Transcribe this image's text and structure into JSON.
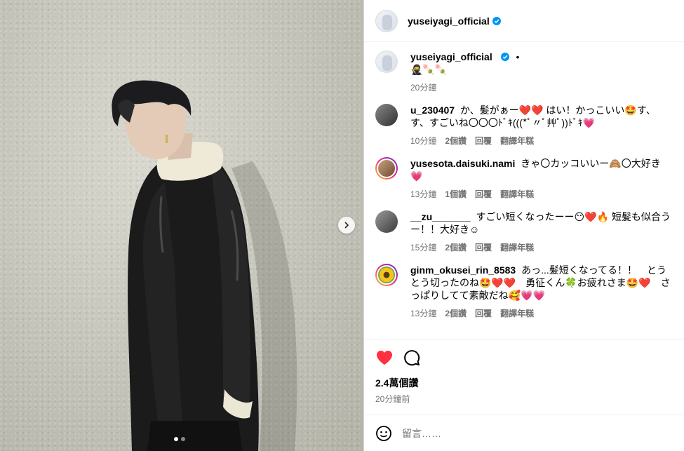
{
  "post": {
    "author": "yuseiyagi_official",
    "caption_emojis": "🥷🍡🍡",
    "caption_dot": "•",
    "caption_time": "20分鐘"
  },
  "comments": [
    {
      "user": "u_230407",
      "text": "か、髪がぁー❤️❤️ はい！かっこいい🤩す、す、すごいね〇〇〇ﾄﾞｷ(((*ﾟ〃ﾟ艸ﾟ))ﾄﾞｷ💗",
      "time": "10分鐘",
      "likes": "2個讚",
      "reply": "回覆",
      "translate": "翻譯年糕"
    },
    {
      "user": "yusesota.daisuki.nami",
      "text": "きゃ〇カッコいいー🙈〇大好き💗",
      "time": "13分鐘",
      "likes": "1個讚",
      "reply": "回覆",
      "translate": "翻譯年糕"
    },
    {
      "user": "__zu_______",
      "text": "すごい短くなったーー😶❤️🔥 短髪も似合うー！！大好き☺",
      "time": "15分鐘",
      "likes": "2個讚",
      "reply": "回覆",
      "translate": "翻譯年糕"
    },
    {
      "user": "ginm_okusei_rin_8583",
      "text": "あっ...髪短くなってる！！　とうとう切ったのね🤩❤️❤️　勇征くん🍀お疲れさま🤩❤️　さっぱりしてて素敵だね🥰💗💗",
      "time": "13分鐘",
      "likes": "2個讚",
      "reply": "回覆",
      "translate": "翻譯年糕"
    }
  ],
  "stats": {
    "views": "2.4萬個讚",
    "posted": "20分鐘前"
  },
  "comment_input": {
    "placeholder": "留言……"
  },
  "colors": {
    "like_red": "#ff3040",
    "verified_blue": "#0095f6",
    "meta_gray": "#737373"
  },
  "icons": [
    "verified-icon",
    "heart-icon",
    "comment-icon",
    "emoji-icon",
    "chevron-right-icon"
  ]
}
